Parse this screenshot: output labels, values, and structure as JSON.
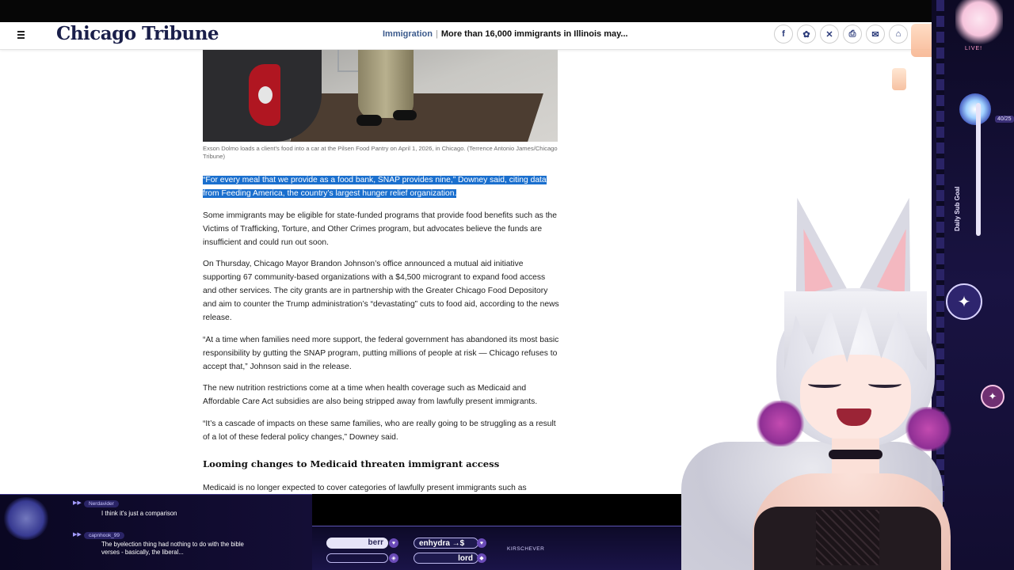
{
  "header": {
    "logo": "Chicago Tribune",
    "section": "Immigration",
    "separator": "|",
    "headline": "More than 16,000 immigrants in Illinois may..."
  },
  "share_icons": [
    "facebook-icon",
    "bluesky-icon",
    "x-icon",
    "print-icon",
    "email-icon",
    "gift-icon"
  ],
  "share_glyphs": [
    "f",
    "✿",
    "✕",
    "⎙",
    "✉",
    "⌂"
  ],
  "article": {
    "caption": "Exson Dolmo loads a client's food into a car at the Pilsen Food Pantry on April 1, 2026, in Chicago. (Terrence Antonio James/Chicago Tribune)",
    "p1": "“For every meal that we provide as a food bank, SNAP provides nine,” Downey said, citing data from Feeding America, the country’s largest hunger relief organization.",
    "p2": "Some immigrants may be eligible for state-funded programs that provide food benefits such as the Victims of Trafficking, Torture, and Other Crimes program, but advocates believe the funds are insufficient and could run out soon.",
    "p3": "On Thursday, Chicago Mayor Brandon Johnson’s office announced a mutual aid initiative supporting 67 community-based organizations with a $4,500 microgrant to expand food access and other services. The city grants are in partnership with the Greater Chicago Food Depository and aim to counter the Trump administration’s “devastating” cuts to food aid, according to the news release.",
    "p4": "“At a time when families need more support, the federal government has abandoned its most basic responsibility by gutting the SNAP program, putting millions of people at risk — Chicago refuses to accept that,” Johnson said in the release.",
    "p5": "The new nutrition restrictions come at a time when health coverage such as Medicaid and Affordable Care Act subsidies are also being stripped away from lawfully present immigrants.",
    "p6": "“It’s a cascade of impacts on these same families, who are really going to be struggling as a result of a lot of these federal policy changes,” Downey said.",
    "h2": "Looming changes to Medicaid threaten immigrant access",
    "p7": "Medicaid is no longer expected to cover categories of lawfully present immigrants such as"
  },
  "stream": {
    "live_label": "LIVE!",
    "sub_goal_label": "Daily Sub Goal",
    "sub_goal_count": "40/25",
    "chat": [
      {
        "user": "Nerdavider",
        "text": "I think it's just a comparison"
      },
      {
        "user": "capnhook_99",
        "text": "The byelection thing had nothing to do with the bible verses - basically, the liberal..."
      }
    ],
    "music": {
      "artist_partial": "berr",
      "track1": "enhydra →$",
      "track2": "lord",
      "ticker": "KIRSCHEVER"
    }
  },
  "colors": {
    "selection": "#1a6fce",
    "logo": "#1a1f4a",
    "section_link": "#3b5a8c",
    "overlay_bg": "#0d0a24"
  }
}
